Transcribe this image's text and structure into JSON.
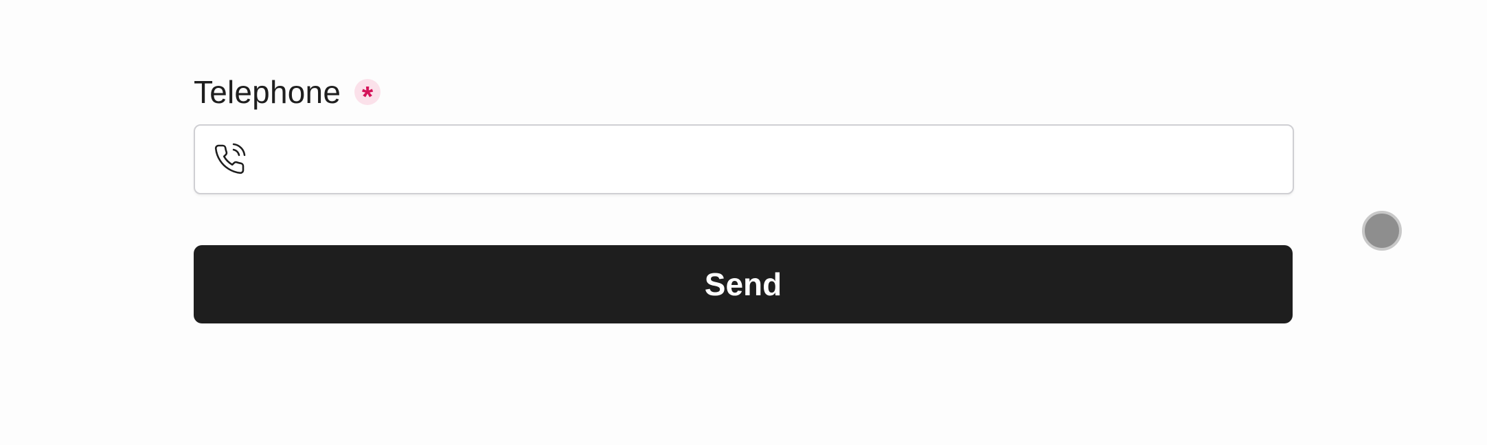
{
  "form": {
    "telephone_label": "Telephone",
    "required_marker": "*",
    "telephone_value": "",
    "telephone_placeholder": "",
    "phone_icon": "phone-call-icon",
    "send_label": "Send"
  },
  "colors": {
    "button_bg": "#1e1e1e",
    "required_accent": "#d4145a",
    "required_badge_bg": "#fbe1ea",
    "input_border": "#cfcfd3",
    "floating_dot": "#8e8e8e"
  }
}
